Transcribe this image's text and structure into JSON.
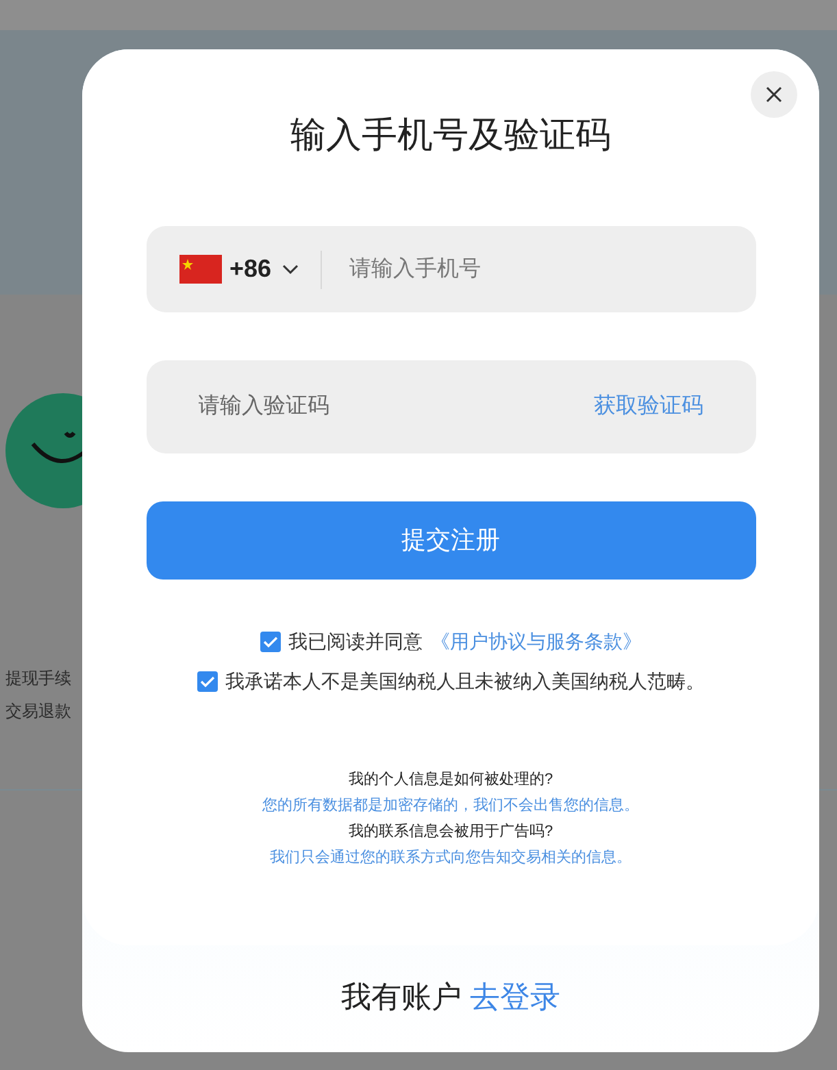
{
  "background": {
    "left_lines": [
      "提现手续",
      "交易退款"
    ]
  },
  "dialog": {
    "title": "输入手机号及验证码",
    "phone": {
      "country_code": "+86",
      "placeholder": "请输入手机号"
    },
    "code": {
      "placeholder": "请输入验证码",
      "action": "获取验证码"
    },
    "submit": "提交注册",
    "agreements": [
      {
        "checked": true,
        "text": "我已阅读并同意",
        "link": "《用户协议与服务条款》"
      },
      {
        "checked": true,
        "text": "我承诺本人不是美国纳税人且未被纳入美国纳税人范畴。"
      }
    ],
    "faq": [
      {
        "kind": "question",
        "text": "我的个人信息是如何被处理的?"
      },
      {
        "kind": "answer",
        "text": "您的所有数据都是加密存储的，我们不会出售您的信息。"
      },
      {
        "kind": "question",
        "text": "我的联系信息会被用于广告吗?"
      },
      {
        "kind": "answer",
        "text": "我们只会通过您的联系方式向您告知交易相关的信息。"
      }
    ],
    "footer": {
      "text": "我有账户",
      "link": "去登录"
    }
  }
}
